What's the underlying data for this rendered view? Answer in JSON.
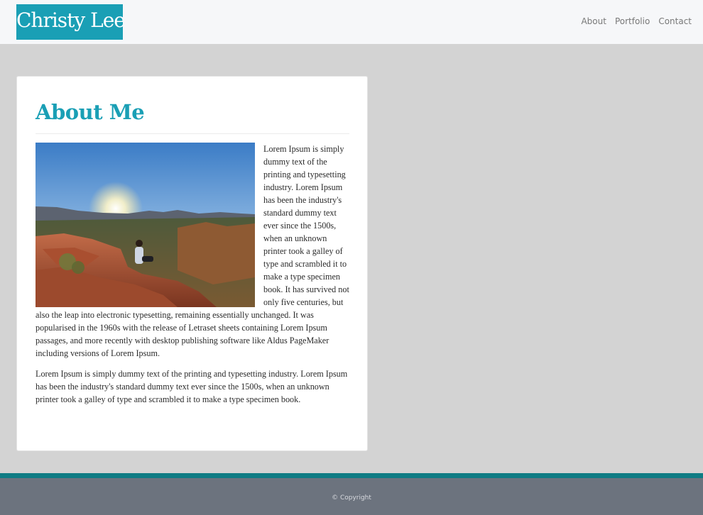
{
  "header": {
    "brand": "Christy Lee",
    "nav": [
      "About",
      "Portfolio",
      "Contact"
    ]
  },
  "main": {
    "title": "About Me",
    "paragraph1": "Lorem Ipsum is simply dummy text of the printing and typesetting industry. Lorem Ipsum has been the industry's standard dummy text ever since the 1500s, when an unknown printer took a galley of type and scrambled it to make a type specimen book. It has survived not only five centuries, but also the leap into electronic typesetting, remaining essentially unchanged. It was popularised in the 1960s with the release of Letraset sheets containing Lorem Ipsum passages, and more recently with desktop publishing software like Aldus PageMaker including versions of Lorem Ipsum.",
    "paragraph2": "Lorem Ipsum is simply dummy text of the printing and typesetting industry. Lorem Ipsum has been the industry's standard dummy text ever since the 1500s, when an unknown printer took a galley of type and scrambled it to make a type specimen book."
  },
  "footer": {
    "copyright": "© Copyright"
  },
  "colors": {
    "accent": "#1a9fb5",
    "page_background": "#d3d3d3",
    "footer_stripe": "#0f7c84",
    "footer_background": "#6c737e"
  }
}
